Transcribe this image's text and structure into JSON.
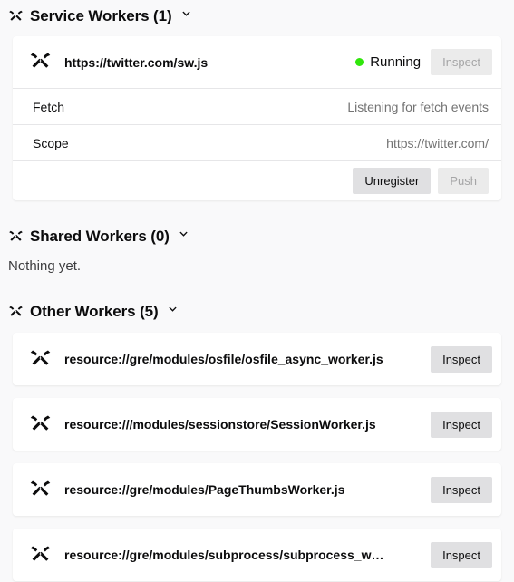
{
  "theme": {
    "page_background": "#f9f9fa",
    "card_background": "#ffffff",
    "text_color": "#0c0c0d",
    "muted_text_color": "#737373",
    "button_background": "#e0e0e2",
    "button_disabled_text": "#a5a5a6",
    "status_running_color": "#30e60b"
  },
  "sections": {
    "service_workers": {
      "icon": "crossed-hammers-icon",
      "title": "Service Workers (1)",
      "toggle_icon": "chevron-down-icon",
      "worker": {
        "icon": "crossed-hammers-icon",
        "url": "https://twitter.com/sw.js",
        "status_label": "Running",
        "status_dot": "status-dot-running",
        "inspect_label": "Inspect",
        "inspect_disabled": true,
        "rows": [
          {
            "label": "Fetch",
            "value": "Listening for fetch events"
          },
          {
            "label": "Scope",
            "value": "https://twitter.com/"
          }
        ],
        "actions": [
          {
            "label": "Unregister",
            "disabled": false
          },
          {
            "label": "Push",
            "disabled": true
          }
        ]
      }
    },
    "shared_workers": {
      "icon": "crossed-hammers-icon",
      "title": "Shared Workers (0)",
      "toggle_icon": "chevron-down-icon",
      "empty_text": "Nothing yet."
    },
    "other_workers": {
      "icon": "crossed-hammers-icon",
      "title": "Other Workers (5)",
      "toggle_icon": "chevron-down-icon",
      "workers": [
        {
          "icon": "crossed-hammers-icon",
          "url": "resource://gre/modules/osfile/osfile_async_worker.js",
          "inspect_label": "Inspect"
        },
        {
          "icon": "crossed-hammers-icon",
          "url": "resource:///modules/sessionstore/SessionWorker.js",
          "inspect_label": "Inspect"
        },
        {
          "icon": "crossed-hammers-icon",
          "url": "resource://gre/modules/PageThumbsWorker.js",
          "inspect_label": "Inspect"
        },
        {
          "icon": "crossed-hammers-icon",
          "url": "resource://gre/modules/subprocess/subprocess_w…",
          "inspect_label": "Inspect"
        }
      ]
    }
  }
}
